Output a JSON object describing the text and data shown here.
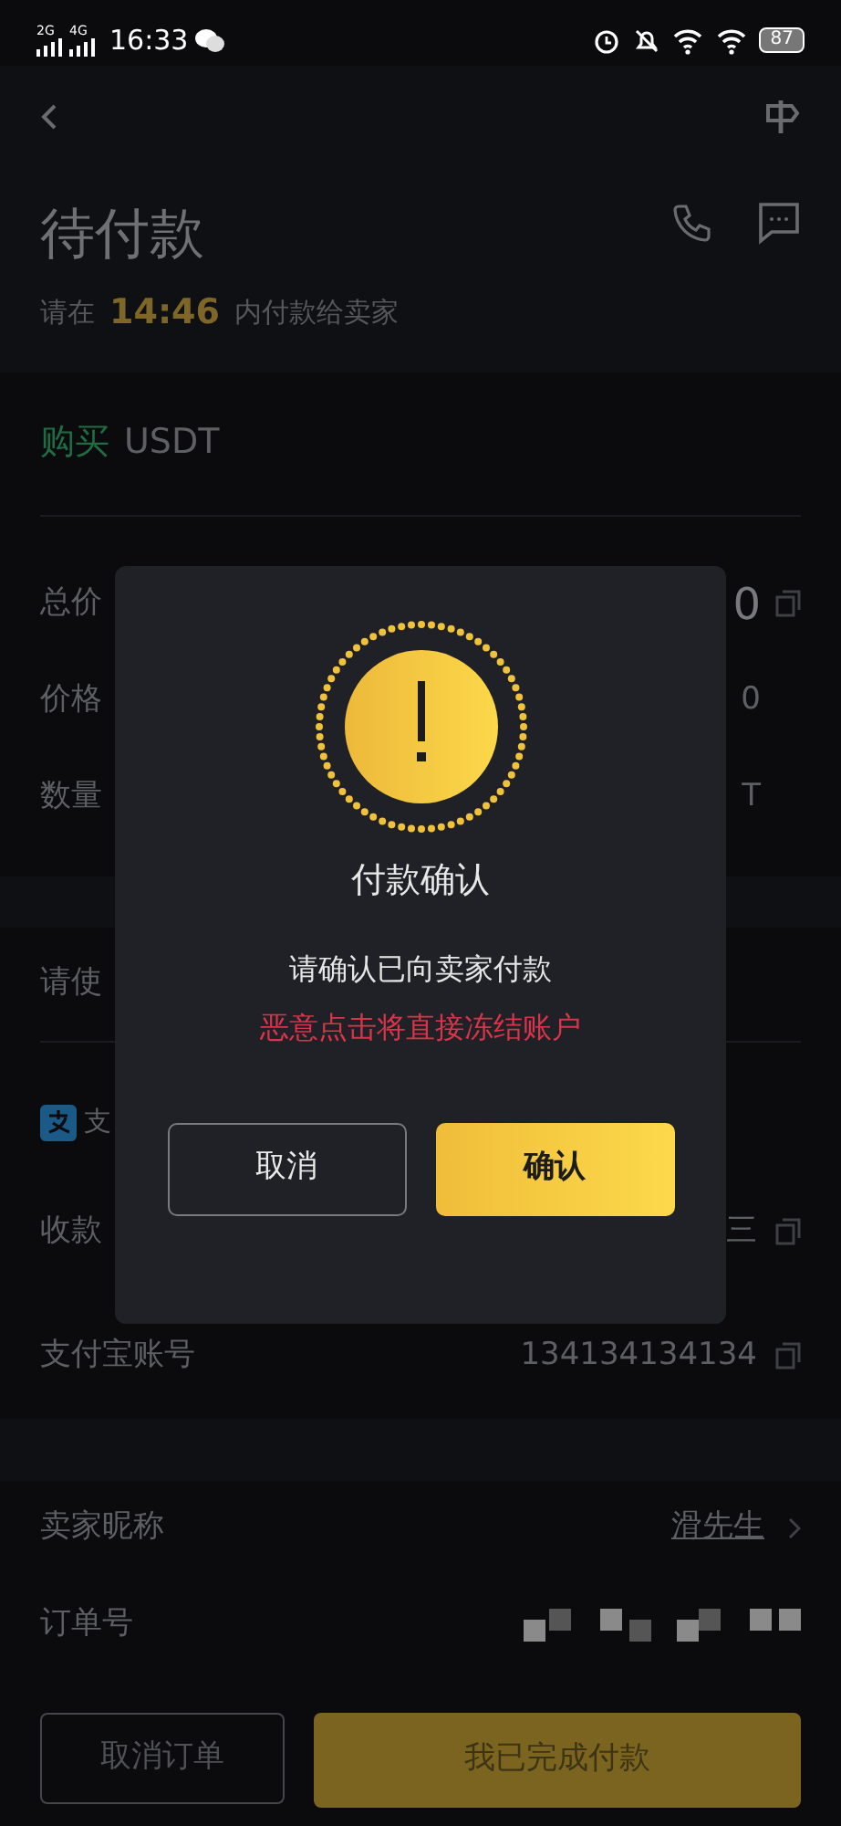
{
  "status_bar": {
    "network_1": "2G",
    "network_2": "4G",
    "time": "16:33",
    "battery": "87"
  },
  "header": {
    "title": "待付款",
    "deadline_prefix": "请在",
    "countdown": "14:46",
    "deadline_suffix": "内付款给卖家"
  },
  "order": {
    "side": "购买",
    "asset": "USDT",
    "rows": [
      {
        "label": "总价",
        "value": "0",
        "copy": true
      },
      {
        "label": "价格",
        "value": "0",
        "copy": false
      },
      {
        "label": "数量",
        "value": "T",
        "copy": false
      }
    ]
  },
  "payment": {
    "instruction": "请使",
    "method": "支",
    "rows": [
      {
        "label": "收款",
        "value": "三",
        "copy": true
      },
      {
        "label": "支付宝账号",
        "value": "134134134134",
        "copy": true
      }
    ]
  },
  "seller": {
    "nickname_label": "卖家昵称",
    "nickname": "滑先生",
    "order_no_label": "订单号"
  },
  "actions": {
    "cancel": "取消订单",
    "paid": "我已完成付款"
  },
  "dialog": {
    "title": "付款确认",
    "message": "请确认已向卖家付款",
    "warning": "恶意点击将直接冻结账户",
    "buttons": [
      {
        "label": "取消",
        "kind": "secondary"
      },
      {
        "label": "确认",
        "kind": "primary"
      }
    ]
  }
}
